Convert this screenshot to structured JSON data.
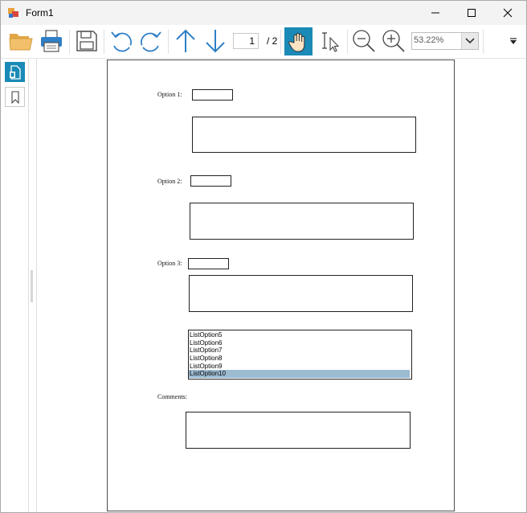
{
  "window": {
    "title": "Form1"
  },
  "toolbar": {
    "page_number": "1",
    "page_total": "/ 2",
    "zoom": "53.22%"
  },
  "document": {
    "option1_label": "Option 1:",
    "option2_label": "Option 2:",
    "option3_label": "Option 3:",
    "comments_label": "Comments:",
    "list_items": [
      "ListOption5",
      "ListOption6",
      "ListOption7",
      "ListOption8",
      "ListOption9",
      "ListOption10"
    ],
    "selected_item": "ListOption10"
  },
  "colors": {
    "accent": "#1a8ab6",
    "selection": "#9dbbd1",
    "icon_blue": "#2f7fc7"
  }
}
